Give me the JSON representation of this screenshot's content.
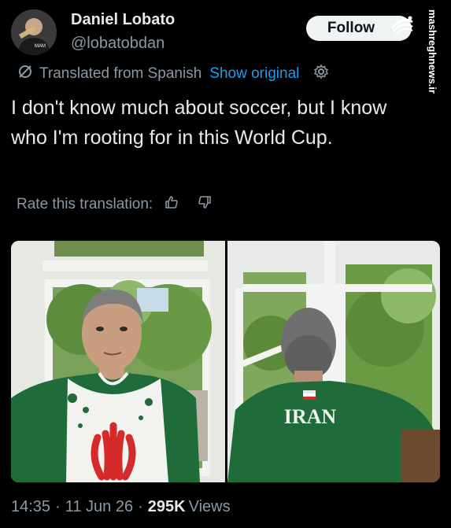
{
  "author": {
    "display_name": "Daniel Lobato",
    "handle": "@lobatobdan",
    "avatar_icon": "profile-avatar-icon"
  },
  "follow_label": "Follow",
  "watermark": {
    "text": "mashreghnews.ir",
    "logo_icon": "mashregh-logo-icon"
  },
  "translation": {
    "label": "Translated from Spanish",
    "show_original": "Show original",
    "rate_label": "Rate this translation:"
  },
  "tweet_text": "I don't know much about soccer, but I know who I'm rooting for in this World Cup.",
  "photos": [
    {
      "name": "selfie-in-iran-shirt"
    },
    {
      "name": "back-view-iran-shirt",
      "shirt_text": "IRAN"
    }
  ],
  "meta": {
    "time": "14:35",
    "date": "11 Jun 26",
    "views_count": "295K",
    "views_label": "Views",
    "separator": "·"
  },
  "colors": {
    "background": "#000000",
    "text": "#e7e9ea",
    "muted": "#8b98a5",
    "link": "#1d9bf0",
    "shirt_green": "#1f6b3a",
    "flag_red": "#d42a2a"
  }
}
